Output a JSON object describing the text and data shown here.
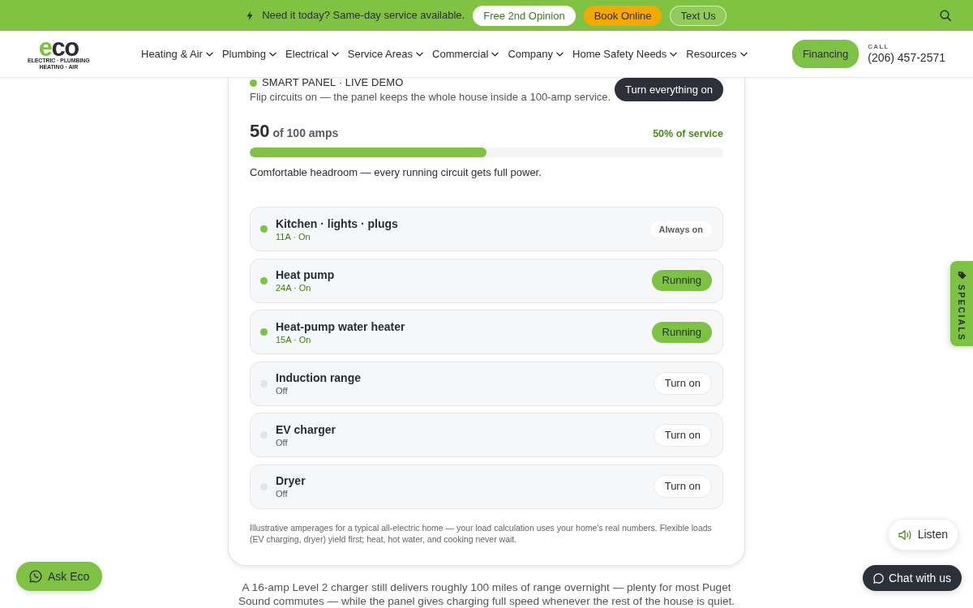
{
  "top_bar": {
    "message": "Need it today? Same-day service available.",
    "buttons": [
      {
        "label": "Free 2nd Opinion",
        "kind": "light"
      },
      {
        "label": "Book Online",
        "kind": "accent"
      },
      {
        "label": "Text Us",
        "kind": "outline"
      }
    ]
  },
  "header": {
    "logo": {
      "wordmark": "eco",
      "tagline": [
        "ELECTRIC · PLUMBING",
        "HEATING · AIR"
      ]
    },
    "nav": [
      {
        "label": "Heating & Air"
      },
      {
        "label": "Plumbing"
      },
      {
        "label": "Electrical"
      },
      {
        "label": "Service Areas"
      },
      {
        "label": "Commercial"
      },
      {
        "label": "Company"
      },
      {
        "label": "Home Safety Needs"
      },
      {
        "label": "Resources"
      }
    ],
    "financing": "Financing",
    "call_label": "CALL",
    "phone": "(206) 457-2571"
  },
  "panel": {
    "eyebrow": "SMART PANEL · LIVE DEMO",
    "subtitle": "Flip circuits on — the panel keeps the whole house inside a 100-amp service.",
    "action": "Turn everything on",
    "amps": "50",
    "amps_of": "of 100 amps",
    "share": "50% of service",
    "level": 0.5,
    "status": "Comfortable headroom — every running circuit gets full power.",
    "circuits": [
      {
        "name": "Kitchen · lights · plugs",
        "detail": "11A · On",
        "on": true,
        "kind": "fixed",
        "control": "Always on"
      },
      {
        "name": "Heat pump",
        "detail": "24A · On",
        "on": true,
        "kind": "switch",
        "control": "Running"
      },
      {
        "name": "Heat-pump water heater",
        "detail": "15A · On",
        "on": true,
        "kind": "switch",
        "control": "Running"
      },
      {
        "name": "Induction range",
        "detail": "Off",
        "on": false,
        "kind": "switch",
        "control": "Turn on"
      },
      {
        "name": "EV charger",
        "detail": "Off",
        "on": false,
        "kind": "switch",
        "control": "Turn on"
      },
      {
        "name": "Dryer",
        "detail": "Off",
        "on": false,
        "kind": "switch",
        "control": "Turn on"
      }
    ],
    "footnote": "Illustrative amperages for a typical all-electric home — your load calculation uses your home's real numbers. Flexible loads (EV charging, dryer) yield first; heat, hot water, and cooking never wait."
  },
  "note": "A 16-amp Level 2 charger still delivers roughly 100 miles of range overnight — plenty for most Puget Sound commutes — while the panel gives charging full speed whenever the rest of the house is quiet.",
  "floating": {
    "ask": "Ask Eco",
    "specials": "SPECIALS",
    "listen": "Listen",
    "chat": "Chat with us"
  }
}
